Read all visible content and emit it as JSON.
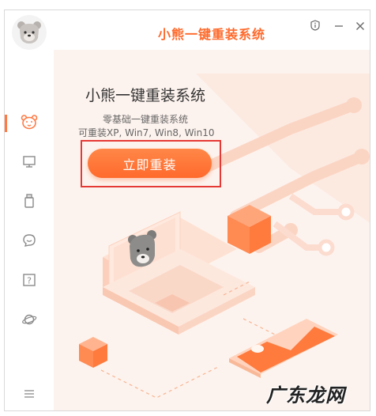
{
  "app": {
    "title": "小熊一键重装系统",
    "accent_color": "#ff6a2c"
  },
  "titlebar": {
    "buttons": [
      {
        "name": "info",
        "icon": "info-icon"
      },
      {
        "name": "minimize",
        "icon": "minimize-icon"
      },
      {
        "name": "close",
        "icon": "close-icon"
      }
    ]
  },
  "sidebar": {
    "logo_icon": "bear-logo-icon",
    "items": [
      {
        "icon": "bear-face-icon",
        "active": true
      },
      {
        "icon": "monitor-icon",
        "active": false
      },
      {
        "icon": "usb-drive-icon",
        "active": false
      },
      {
        "icon": "chat-bubble-icon",
        "active": false
      },
      {
        "icon": "help-icon",
        "active": false
      },
      {
        "icon": "planet-icon",
        "active": false
      }
    ],
    "menu_icon": "menu-icon"
  },
  "hero": {
    "title": "小熊一键重装系统",
    "subtitle": "零基础一键重装系统",
    "supported": "可重装XP, Win7, Win8, Win10",
    "install_label": "立即重装"
  },
  "watermark": "广东龙网"
}
